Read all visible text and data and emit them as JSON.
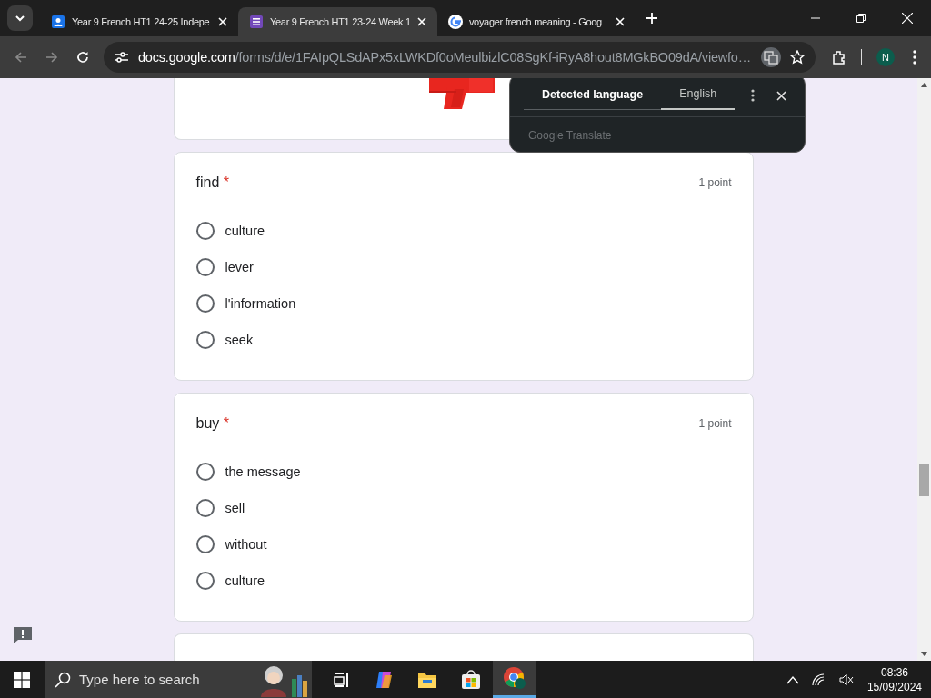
{
  "browser": {
    "tabs": [
      {
        "title": "Year 9 French HT1 24-25 Indepe",
        "kind": "classroom",
        "selected": false
      },
      {
        "title": "Year 9 French HT1 23-24 Week 1",
        "kind": "forms",
        "selected": true
      },
      {
        "title": "voyager french meaning - Goog",
        "kind": "google",
        "selected": false
      }
    ],
    "address": {
      "host": "docs.google.com",
      "path": "/forms/d/e/1FAIpQLSdAPx5xLWKDf0oMeulbizlC08SgKf-iRyA8hout8MGkBO09dA/viewfo…"
    },
    "profile": "N"
  },
  "translate_popup": {
    "tabs": [
      {
        "label": "Detected language",
        "selected": false
      },
      {
        "label": "English",
        "selected": true
      }
    ],
    "brand": "Google",
    "product": "Translate"
  },
  "questions": [
    {
      "title": "find",
      "asterisk": "*",
      "points": "1 point",
      "options": [
        {
          "label": "culture",
          "selected": false
        },
        {
          "label": "lever",
          "selected": false
        },
        {
          "label": "l'information",
          "selected": false
        },
        {
          "label": "seek",
          "selected": false
        }
      ]
    },
    {
      "title": "buy",
      "asterisk": "*",
      "points": "1 point",
      "options": [
        {
          "label": "the message",
          "selected": false
        },
        {
          "label": "sell",
          "selected": false
        },
        {
          "label": "without",
          "selected": false
        },
        {
          "label": "culture",
          "selected": false
        }
      ]
    }
  ],
  "taskbar": {
    "search_placeholder": "Type here to search",
    "time": "08:36",
    "date": "15/09/2024"
  }
}
